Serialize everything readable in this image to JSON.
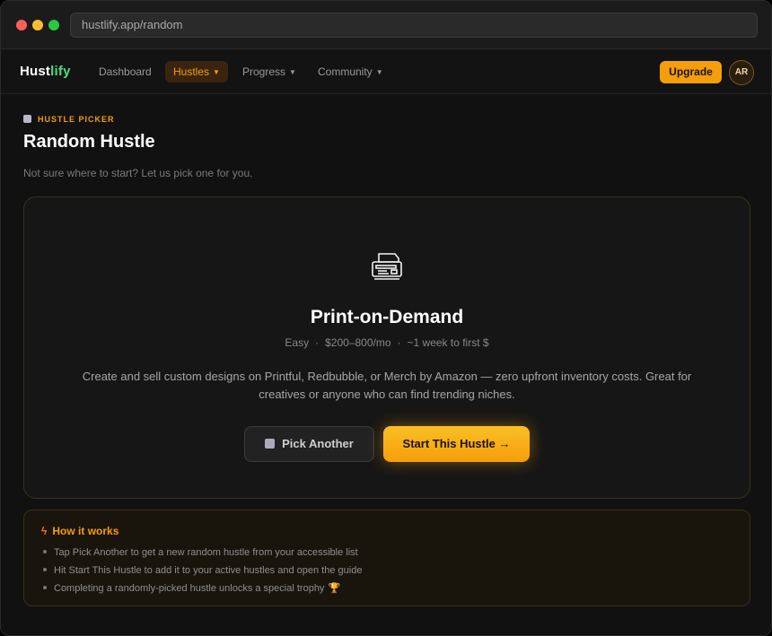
{
  "browser": {
    "url": "hustlify.app/random"
  },
  "nav": {
    "logo_main": "Hust",
    "logo_accent": "lify",
    "items": [
      {
        "label": "Dashboard",
        "has_caret": false
      },
      {
        "label": "Hustles",
        "has_caret": true,
        "active": true
      },
      {
        "label": "Progress",
        "has_caret": true
      },
      {
        "label": "Community",
        "has_caret": true
      }
    ],
    "caret": "▼",
    "upgrade_label": "Upgrade",
    "avatar_initials": "AR"
  },
  "header": {
    "eyebrow": "HUSTLE PICKER",
    "title": "Random Hustle",
    "subtitle": "Not sure where to start? Let us pick one for you."
  },
  "hustle": {
    "icon": "printer-icon",
    "name": "Print-on-Demand",
    "difficulty": "Easy",
    "earnings": "$200–800/mo",
    "time_to_first": "~1 week to first $",
    "separator": "·",
    "description": "Create and sell custom designs on Printful, Redbubble, or Merch by Amazon — zero upfront inventory costs. Great for creatives or anyone who can find trending niches."
  },
  "actions": {
    "pick_another": "Pick Another",
    "start": "Start This Hustle →"
  },
  "how_it_works": {
    "title": "How it works",
    "steps": [
      "Tap Pick Another to get a new random hustle from your accessible list",
      "Hit Start This Hustle to add it to your active hustles and open the guide",
      "Completing a randomly-picked hustle unlocks a special trophy"
    ],
    "trophy_glyph": "🏆"
  },
  "colors": {
    "accent": "#f59e0b",
    "brand_green": "#4ade80",
    "background": "#111111"
  }
}
